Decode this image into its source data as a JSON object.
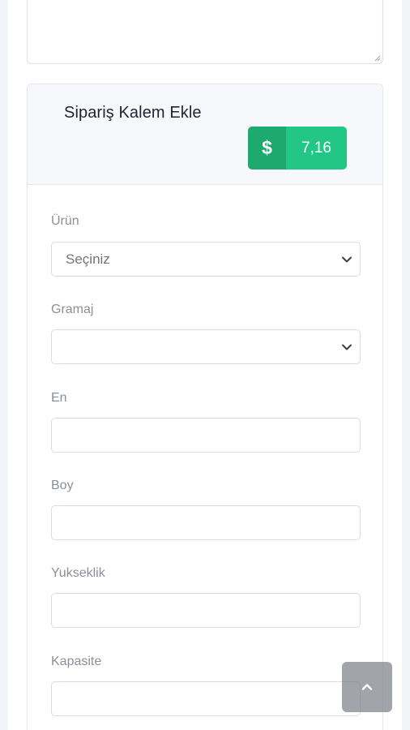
{
  "section": {
    "title": "Sipariş Kalem Ekle",
    "price": {
      "icon": "dollar-icon",
      "symbol": "$",
      "value": "7,16",
      "colors": {
        "icon_bg": "#1eaa6e",
        "value_bg": "#23c785"
      }
    }
  },
  "fields": {
    "urun": {
      "label": "Ürün",
      "selected": "Seçiniz"
    },
    "gramaj": {
      "label": "Gramaj",
      "selected": ""
    },
    "en": {
      "label": "En",
      "value": ""
    },
    "boy": {
      "label": "Boy",
      "value": ""
    },
    "yukseklik": {
      "label": "Yukseklik",
      "value": ""
    },
    "kapasite": {
      "label": "Kapasite",
      "value": ""
    }
  },
  "scroll_top": {
    "icon": "chevron-up-icon"
  }
}
